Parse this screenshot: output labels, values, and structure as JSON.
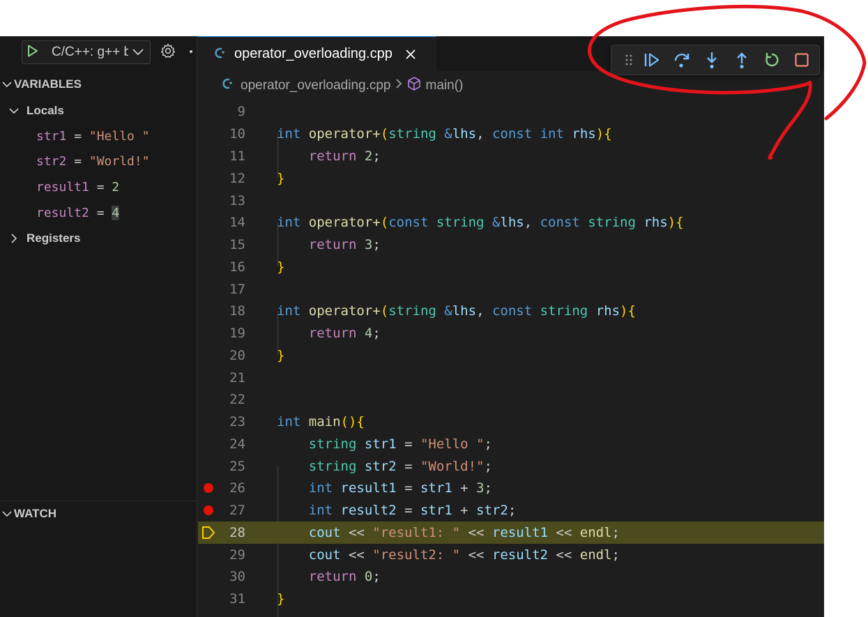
{
  "sidebar": {
    "run_config": "C/C++: g++ build and debug active file",
    "variables_header": "VARIABLES",
    "locals_label": "Locals",
    "registers_label": "Registers",
    "watch_header": "WATCH",
    "locals": [
      {
        "name": "str1",
        "eq": " = ",
        "value": "\"Hello \"",
        "kind": "string"
      },
      {
        "name": "str2",
        "eq": " = ",
        "value": "\"World!\"",
        "kind": "string"
      },
      {
        "name": "result1",
        "eq": " = ",
        "value": "2",
        "kind": "number"
      },
      {
        "name": "result2",
        "eq": " = ",
        "value": "4",
        "kind": "number"
      }
    ]
  },
  "editor": {
    "tab_title": "operator_overloading.cpp",
    "breadcrumb_file": "operator_overloading.cpp",
    "breadcrumb_symbol": "main()",
    "current_line": "28",
    "breakpoint_lines": [
      "26",
      "27"
    ],
    "lines": [
      {
        "n": "9"
      },
      {
        "n": "10"
      },
      {
        "n": "11"
      },
      {
        "n": "12"
      },
      {
        "n": "13"
      },
      {
        "n": "14"
      },
      {
        "n": "15"
      },
      {
        "n": "16"
      },
      {
        "n": "17"
      },
      {
        "n": "18"
      },
      {
        "n": "19"
      },
      {
        "n": "20"
      },
      {
        "n": "21"
      },
      {
        "n": "22"
      },
      {
        "n": "23"
      },
      {
        "n": "24"
      },
      {
        "n": "25"
      },
      {
        "n": "26"
      },
      {
        "n": "27"
      },
      {
        "n": "28"
      },
      {
        "n": "29"
      },
      {
        "n": "30"
      },
      {
        "n": "31"
      }
    ],
    "code": {
      "l10": {
        "t1": "int",
        "t2": "operator+",
        "t3": "(",
        "t4": "string",
        "t5": "&",
        "t6": "lhs",
        "t7": ", ",
        "t8": "const",
        "t9": "int",
        "t10": "rhs",
        "t11": "){"
      },
      "l11": {
        "t1": "return",
        "t2": "2",
        "t3": ";"
      },
      "l12": {
        "t1": "}"
      },
      "l14": {
        "t1": "int",
        "t2": "operator+",
        "t3": "(",
        "t4": "const",
        "t5": "string",
        "t6": "&",
        "t7": "lhs",
        "t8": ", ",
        "t9": "const",
        "t10": "string",
        "t11": "rhs",
        "t12": "){"
      },
      "l15": {
        "t1": "return",
        "t2": "3",
        "t3": ";"
      },
      "l16": {
        "t1": "}"
      },
      "l18": {
        "t1": "int",
        "t2": "operator+",
        "t3": "(",
        "t4": "string",
        "t5": "&",
        "t6": "lhs",
        "t7": ", ",
        "t8": "const",
        "t9": "string",
        "t10": "rhs",
        "t11": "){"
      },
      "l19": {
        "t1": "return",
        "t2": "4",
        "t3": ";"
      },
      "l20": {
        "t1": "}"
      },
      "l23": {
        "t1": "int",
        "t2": "main",
        "t3": "(){"
      },
      "l24": {
        "t1": "string",
        "t2": "str1",
        "t3": " = ",
        "t4": "\"Hello \"",
        "t5": ";"
      },
      "l25": {
        "t1": "string",
        "t2": "str2",
        "t3": " = ",
        "t4": "\"World!\"",
        "t5": ";"
      },
      "l26": {
        "t1": "int",
        "t2": "result1",
        "t3": " = ",
        "t4": "str1",
        "t5": " + ",
        "t6": "3",
        "t7": ";"
      },
      "l27": {
        "t1": "int",
        "t2": "result2",
        "t3": " = ",
        "t4": "str1",
        "t5": " + ",
        "t6": "str2",
        "t7": ";"
      },
      "l28": {
        "t1": "cout",
        "t2": " << ",
        "t3": "\"result1: \"",
        "t4": " << ",
        "t5": "result1",
        "t6": " << ",
        "t7": "endl",
        "t8": ";"
      },
      "l29": {
        "t1": "cout",
        "t2": " << ",
        "t3": "\"result2: \"",
        "t4": " << ",
        "t5": "result2",
        "t6": " << ",
        "t7": "endl",
        "t8": ";"
      },
      "l30": {
        "t1": "return",
        "t2": "0",
        "t3": ";"
      },
      "l31": {
        "t1": "}"
      }
    }
  },
  "debug_toolbar": {
    "buttons": [
      "continue",
      "step-over",
      "step-into",
      "step-out",
      "restart",
      "stop"
    ],
    "colors": {
      "step": "#75beff",
      "restart": "#89d185",
      "stop": "#f48771"
    }
  },
  "theme": {
    "background": "#1e1e1e",
    "sidebar": "#181818",
    "current_line_highlight": "#4b4b1e",
    "breakpoint": "#e51400",
    "annotation": "#e3141b"
  }
}
